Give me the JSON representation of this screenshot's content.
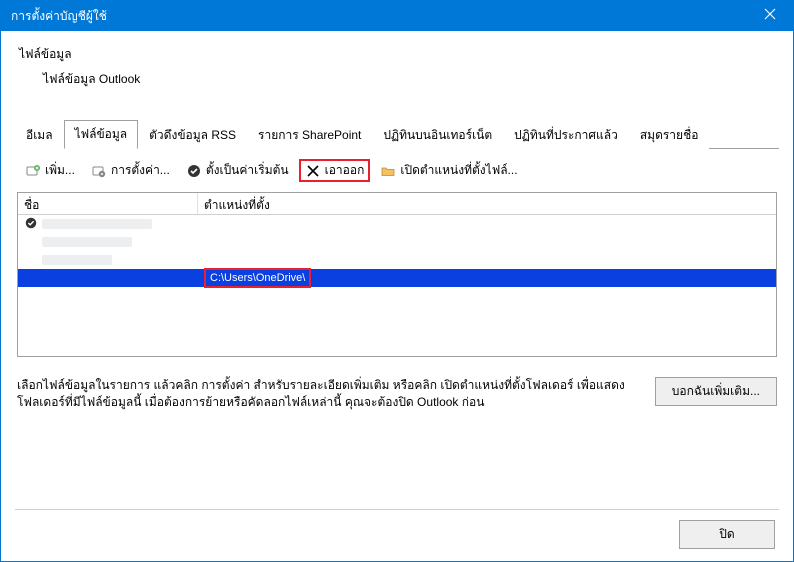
{
  "window": {
    "title": "การตั้งค่าบัญชีผู้ใช้"
  },
  "section": {
    "heading": "ไฟล์ข้อมูล",
    "sub": "ไฟล์ข้อมูล Outlook"
  },
  "tabs": {
    "email": "อีเมล",
    "datafiles": "ไฟล์ข้อมูล",
    "rss": "ตัวดึงข้อมูล RSS",
    "sharepoint": "รายการ SharePoint",
    "ical": "ปฏิทินบนอินเทอร์เน็ต",
    "pubcal": "ปฏิทินที่ประกาศแล้ว",
    "addr": "สมุดรายชื่อ"
  },
  "toolbar": {
    "add": "เพิ่ม...",
    "settings": "การตั้งค่า...",
    "setdefault": "ตั้งเป็นค่าเริ่มต้น",
    "remove": "เอาออก",
    "openloc": "เปิดตำแหน่งที่ตั้งไฟล์..."
  },
  "columns": {
    "name": "ชื่อ",
    "location": "ตำแหน่งที่ตั้ง"
  },
  "selected_row": {
    "location": "C:\\Users\\OneDrive\\"
  },
  "info": "เลือกไฟล์ข้อมูลในรายการ แล้วคลิก การตั้งค่า สำหรับรายละเอียดเพิ่มเติม หรือคลิก เปิดตำแหน่งที่ตั้งโฟลเดอร์ เพื่อแสดงโฟลเดอร์ที่มีไฟล์ข้อมูลนี้ เมื่อต้องการย้ายหรือคัดลอกไฟล์เหล่านี้ คุณจะต้องปิด Outlook ก่อน",
  "buttons": {
    "more": "บอกฉันเพิ่มเติม...",
    "close": "ปิด"
  }
}
